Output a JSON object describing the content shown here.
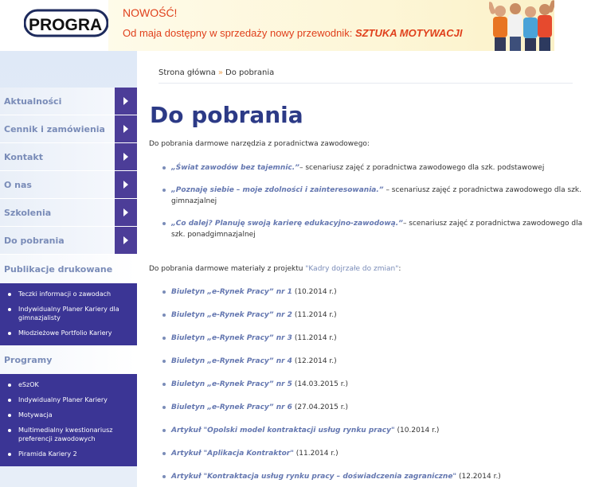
{
  "header": {
    "logo_text": "PROGRA",
    "banner_new": "NOWOŚĆ!",
    "banner_line": "Od maja dostępny w sprzedaży nowy przewodnik:",
    "banner_book": "SZTUKA MOTYWACJI"
  },
  "sidebar": {
    "menu": [
      {
        "label": "Aktualności"
      },
      {
        "label": "Cennik i zamówienia"
      },
      {
        "label": "Kontakt"
      },
      {
        "label": "O nas"
      },
      {
        "label": "Szkolenia"
      },
      {
        "label": "Do pobrania"
      }
    ],
    "publikacje": {
      "title": "Publikacje drukowane",
      "items": [
        "Teczki informacji o zawodach",
        "Indywidualny Planer Kariery dla gimnazjalisty",
        "Młodzieżowe Portfolio Kariery"
      ]
    },
    "programy": {
      "title": "Programy",
      "items": [
        "eSzOK",
        "Indywidualny Planer Kariery",
        "Motywacja",
        "Multimedialny kwestionariusz preferencji zawodowych",
        "Piramida Kariery 2"
      ]
    }
  },
  "content": {
    "breadcrumb_home": "Strona główna",
    "breadcrumb_sep": "»",
    "breadcrumb_current": "Do pobrania",
    "title": "Do pobrania",
    "intro1": "Do pobrania darmowe narzędzia z poradnictwa zawodowego:",
    "tools": [
      {
        "link": "„Świat zawodów bez tajemnic.”",
        "desc": "– scenariusz zajęć z poradnictwa zawodowego dla szk. podstawowej"
      },
      {
        "link": "„Poznaję siebie – moje zdolności i zainteresowania.”",
        "desc": " – scenariusz zajęć z poradnictwa zawodowego dla szk. gimnazjalnej"
      },
      {
        "link": "„Co dalej? Planuję swoją karierę edukacyjno-zawodową.”",
        "desc": "– scenariusz zajęć z poradnictwa zawodowego dla szk. ponadgimnazjalnej"
      }
    ],
    "intro2_prefix": "Do pobrania darmowe materiały z projektu ",
    "intro2_project": "\"Kadry dojrzałe do zmian\"",
    "intro2_suffix": ":",
    "materials": [
      {
        "link": "Biuletyn „e-Rynek Pracy” nr 1",
        "date": " (10.2014 r.)"
      },
      {
        "link": "Biuletyn „e-Rynek Pracy” nr 2",
        "date": " (11.2014 r.)"
      },
      {
        "link": "Biuletyn „e-Rynek Pracy” nr 3",
        "date": " (11.2014 r.)"
      },
      {
        "link": "Biuletyn „e-Rynek Pracy” nr 4",
        "date": " (12.2014 r.)"
      },
      {
        "link": "Biuletyn „e-Rynek Pracy” nr 5",
        "date": " (14.03.2015 r.)"
      },
      {
        "link": "Biuletyn „e-Rynek Pracy” nr 6",
        "date": " (27.04.2015 r.)"
      },
      {
        "link": "Artykuł \"Opolski model kontraktacji usług rynku pracy\"",
        "date": " (10.2014 r.)"
      },
      {
        "link": "Artykuł \"Aplikacja Kontraktor\"",
        "date": " (11.2014 r.)"
      },
      {
        "link": "Artykuł \"Kontraktacja usług rynku pracy – doświadczenia zagraniczne\"",
        "date": " (12.2014 r.)"
      }
    ]
  }
}
